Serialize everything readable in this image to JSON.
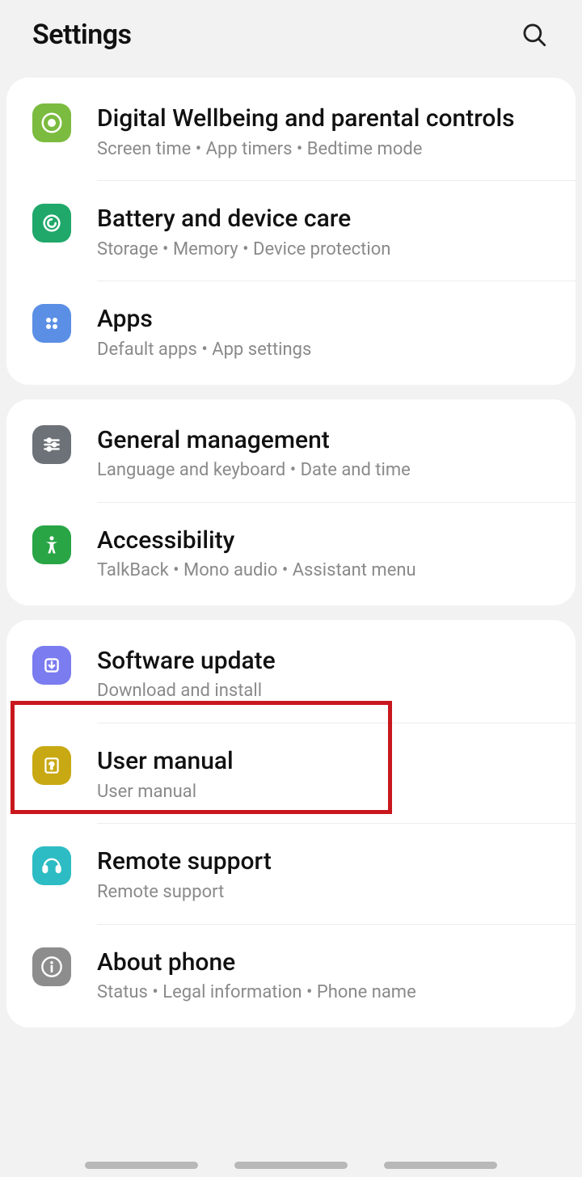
{
  "header": {
    "title": "Settings"
  },
  "groups": [
    {
      "items": [
        {
          "key": "digital-wellbeing",
          "title": "Digital Wellbeing and parental controls",
          "sub": "Screen time • App timers • Bedtime mode",
          "iconClass": "ic-green1"
        },
        {
          "key": "battery",
          "title": "Battery and device care",
          "sub": "Storage • Memory • Device protection",
          "iconClass": "ic-green2"
        },
        {
          "key": "apps",
          "title": "Apps",
          "sub": "Default apps • App settings",
          "iconClass": "ic-blue1"
        }
      ]
    },
    {
      "items": [
        {
          "key": "general",
          "title": "General management",
          "sub": "Language and keyboard • Date and time",
          "iconClass": "ic-grey1"
        },
        {
          "key": "accessibility",
          "title": "Accessibility",
          "sub": "TalkBack • Mono audio • Assistant menu",
          "iconClass": "ic-green3"
        }
      ]
    },
    {
      "items": [
        {
          "key": "software-update",
          "title": "Software update",
          "sub": "Download and install",
          "iconClass": "ic-purple"
        },
        {
          "key": "user-manual",
          "title": "User manual",
          "sub": "User manual",
          "iconClass": "ic-yellow"
        },
        {
          "key": "remote-support",
          "title": "Remote support",
          "sub": "Remote support",
          "iconClass": "ic-teal"
        },
        {
          "key": "about-phone",
          "title": "About phone",
          "sub": "Status • Legal information • Phone name",
          "iconClass": "ic-grey2"
        }
      ]
    }
  ],
  "highlightedItem": "software-update"
}
